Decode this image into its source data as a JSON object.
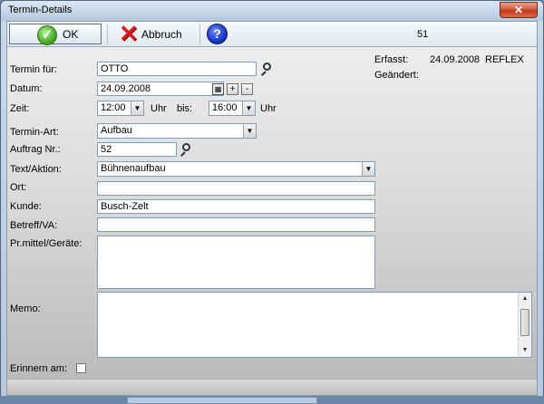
{
  "window": {
    "title": "Termin-Details",
    "close_glyph": "✕"
  },
  "toolbar": {
    "ok_label": "OK",
    "cancel_label": "Abbruch",
    "help_glyph": "?",
    "record_number": "51"
  },
  "info": {
    "erfasst_label": "Erfasst:",
    "erfasst_date": "24.09.2008",
    "erfasst_user": "REFLEX",
    "geaendert_label": "Geändert:"
  },
  "form": {
    "termin_fuer_label": "Termin für:",
    "termin_fuer_value": "OTTO",
    "datum_label": "Datum:",
    "datum_value": "24.09.2008",
    "plus_label": "+",
    "minus_label": "-",
    "zeit_label": "Zeit:",
    "zeit_from": "12:00",
    "uhr_label_1": "Uhr",
    "bis_label": "bis:",
    "zeit_to": "16:00",
    "uhr_label_2": "Uhr",
    "termin_art_label": "Termin-Art:",
    "termin_art_value": "Aufbau",
    "auftrag_label": "Auftrag Nr.:",
    "auftrag_value": "52",
    "text_aktion_label": "Text/Aktion:",
    "text_aktion_value": "Bühnenaufbau",
    "ort_label": "Ort:",
    "ort_value": "",
    "kunde_label": "Kunde:",
    "kunde_value": "Busch-Zelt",
    "betreff_label": "Betreff/VA:",
    "betreff_value": "",
    "prmittel_label": "Pr.mittel/Geräte:",
    "memo_label": "Memo:",
    "erinnern_label": "Erinnern am:"
  },
  "icons": {
    "ok": "check-icon",
    "cancel": "x-icon",
    "help": "help-icon",
    "lookup": "magnifier-icon",
    "calendar": "calendar-icon",
    "dropdown": "chevron-down-icon"
  },
  "colors": {
    "ok_green": "#4fb22c",
    "cancel_red": "#d61e1e",
    "help_blue": "#1636c6",
    "close_red": "#c23a1b"
  }
}
